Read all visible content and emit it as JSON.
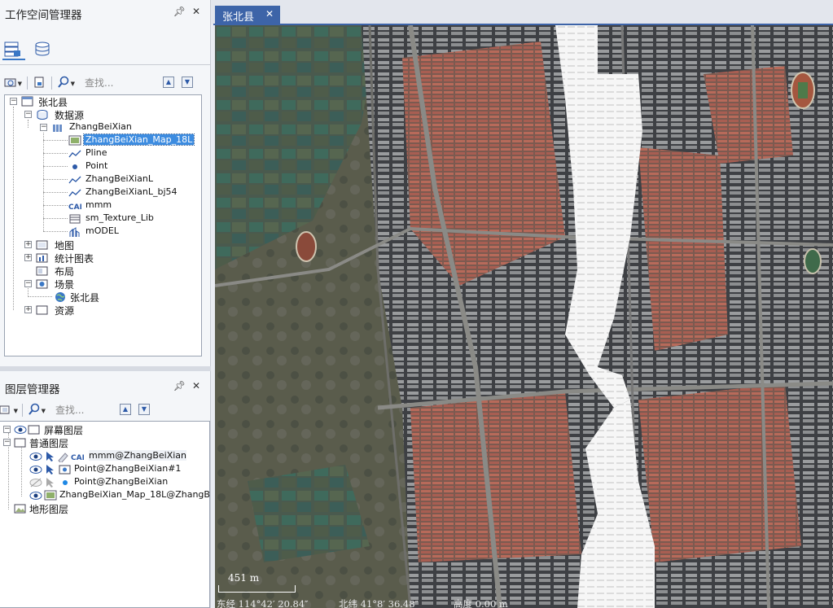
{
  "workspace": {
    "title": "工作空间管理器",
    "search_placeholder": "查找...",
    "tree": {
      "root": "张北县",
      "datasource": "数据源",
      "db": "ZhangBeiXian",
      "datasets": [
        "ZhangBeiXian_Map_18L",
        "Pline",
        "Point",
        "ZhangBeiXianL",
        "ZhangBeiXianL_bj54",
        "mmm",
        "sm_Texture_Lib",
        "mODEL"
      ],
      "maps": "地图",
      "charts": "统计图表",
      "layouts": "布局",
      "scenes": "场景",
      "scene_item": "张北县",
      "resources": "资源"
    }
  },
  "layers": {
    "title": "图层管理器",
    "search_placeholder": "查找...",
    "screen_layers": "屏幕图层",
    "normal_layers": "普通图层",
    "terrain_layers": "地形图层",
    "items": [
      "mmm@ZhangBeiXian",
      "Point@ZhangBeiXian#1",
      "Point@ZhangBeiXian",
      "ZhangBeiXian_Map_18L@ZhangBeiX"
    ],
    "cad_badge": "CAD"
  },
  "document": {
    "tab_title": "张北县"
  },
  "map": {
    "scale_label": "451 m",
    "lon": "东经 114°42′ 20.84″",
    "lat": "北纬 41°8′ 36.48″",
    "alt": "高度 0.00 m"
  },
  "colors": {
    "accent": "#3d64a8",
    "selection": "#3d8ce0"
  }
}
